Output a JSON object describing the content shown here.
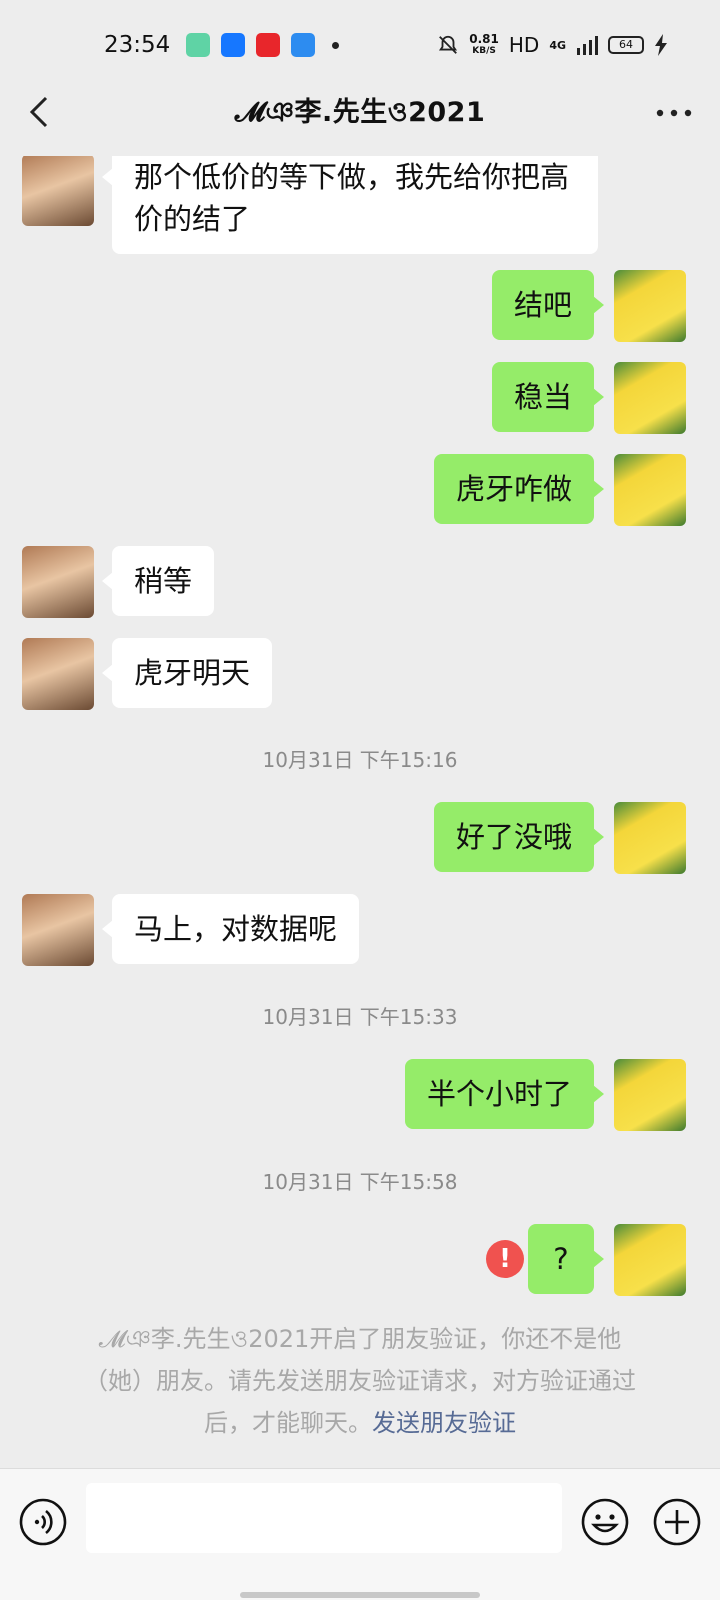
{
  "status_bar": {
    "time": "23:54",
    "speed_value": "0.81",
    "speed_unit": "KB/S",
    "hd": "HD",
    "network": "4G",
    "battery": "64",
    "app_icon_colors": [
      "#5fd3a5",
      "#1677ff",
      "#e8262b",
      "#2d8cf0"
    ]
  },
  "nav": {
    "title": "𝓜ঞ李.先生ও2021",
    "back_icon": "chevron-left-icon",
    "more_icon": "more-horizontal-icon"
  },
  "messages": [
    {
      "side": "left",
      "text": "那个低价的等下做，我先给你把高价的结了"
    },
    {
      "side": "right",
      "text": "结吧"
    },
    {
      "side": "right",
      "text": "稳当"
    },
    {
      "side": "right",
      "text": "虎牙咋做"
    },
    {
      "side": "left",
      "text": "稍等"
    },
    {
      "side": "left",
      "text": "虎牙明天"
    },
    {
      "side": "right",
      "text": "好了没哦"
    },
    {
      "side": "left",
      "text": "马上，对数据呢"
    },
    {
      "side": "right",
      "text": "半个小时了"
    },
    {
      "side": "right",
      "text": "?",
      "failed": true
    }
  ],
  "timestamps": [
    "10月31日 下午15:16",
    "10月31日 下午15:33",
    "10月31日 下午15:58"
  ],
  "system_note": {
    "text": "𝓜ঞ李.先生ও2021开启了朋友验证，你还不是他（她）朋友。请先发送朋友验证请求，对方验证通过后，才能聊天。",
    "link": "发送朋友验证"
  },
  "input_bar": {
    "placeholder": "",
    "voice_icon": "voice-icon",
    "emoji_icon": "emoji-icon",
    "plus_icon": "plus-icon"
  },
  "colors": {
    "background": "#ededed",
    "bubble_self": "#95ec69",
    "bubble_other": "#ffffff",
    "error": "#f0524f",
    "link": "#576b95"
  }
}
